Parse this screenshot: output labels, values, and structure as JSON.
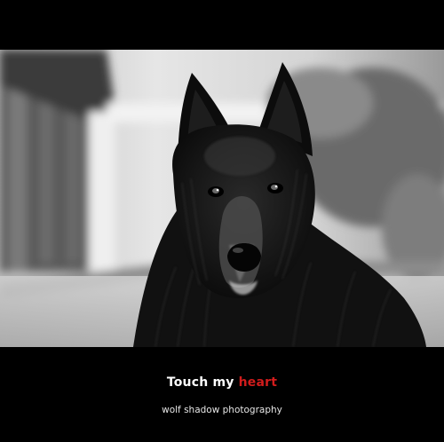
{
  "caption": {
    "title_prefix": "Touch my ",
    "title_highlight": "heart",
    "subtitle": "wolf shadow photography"
  },
  "colors": {
    "background": "#000000",
    "title_text": "#ffffff",
    "highlight": "#d11c1c",
    "subtitle_text": "#e6e6e6"
  },
  "photo": {
    "subject": "black long-haired dog portrait",
    "style": "black-and-white"
  }
}
